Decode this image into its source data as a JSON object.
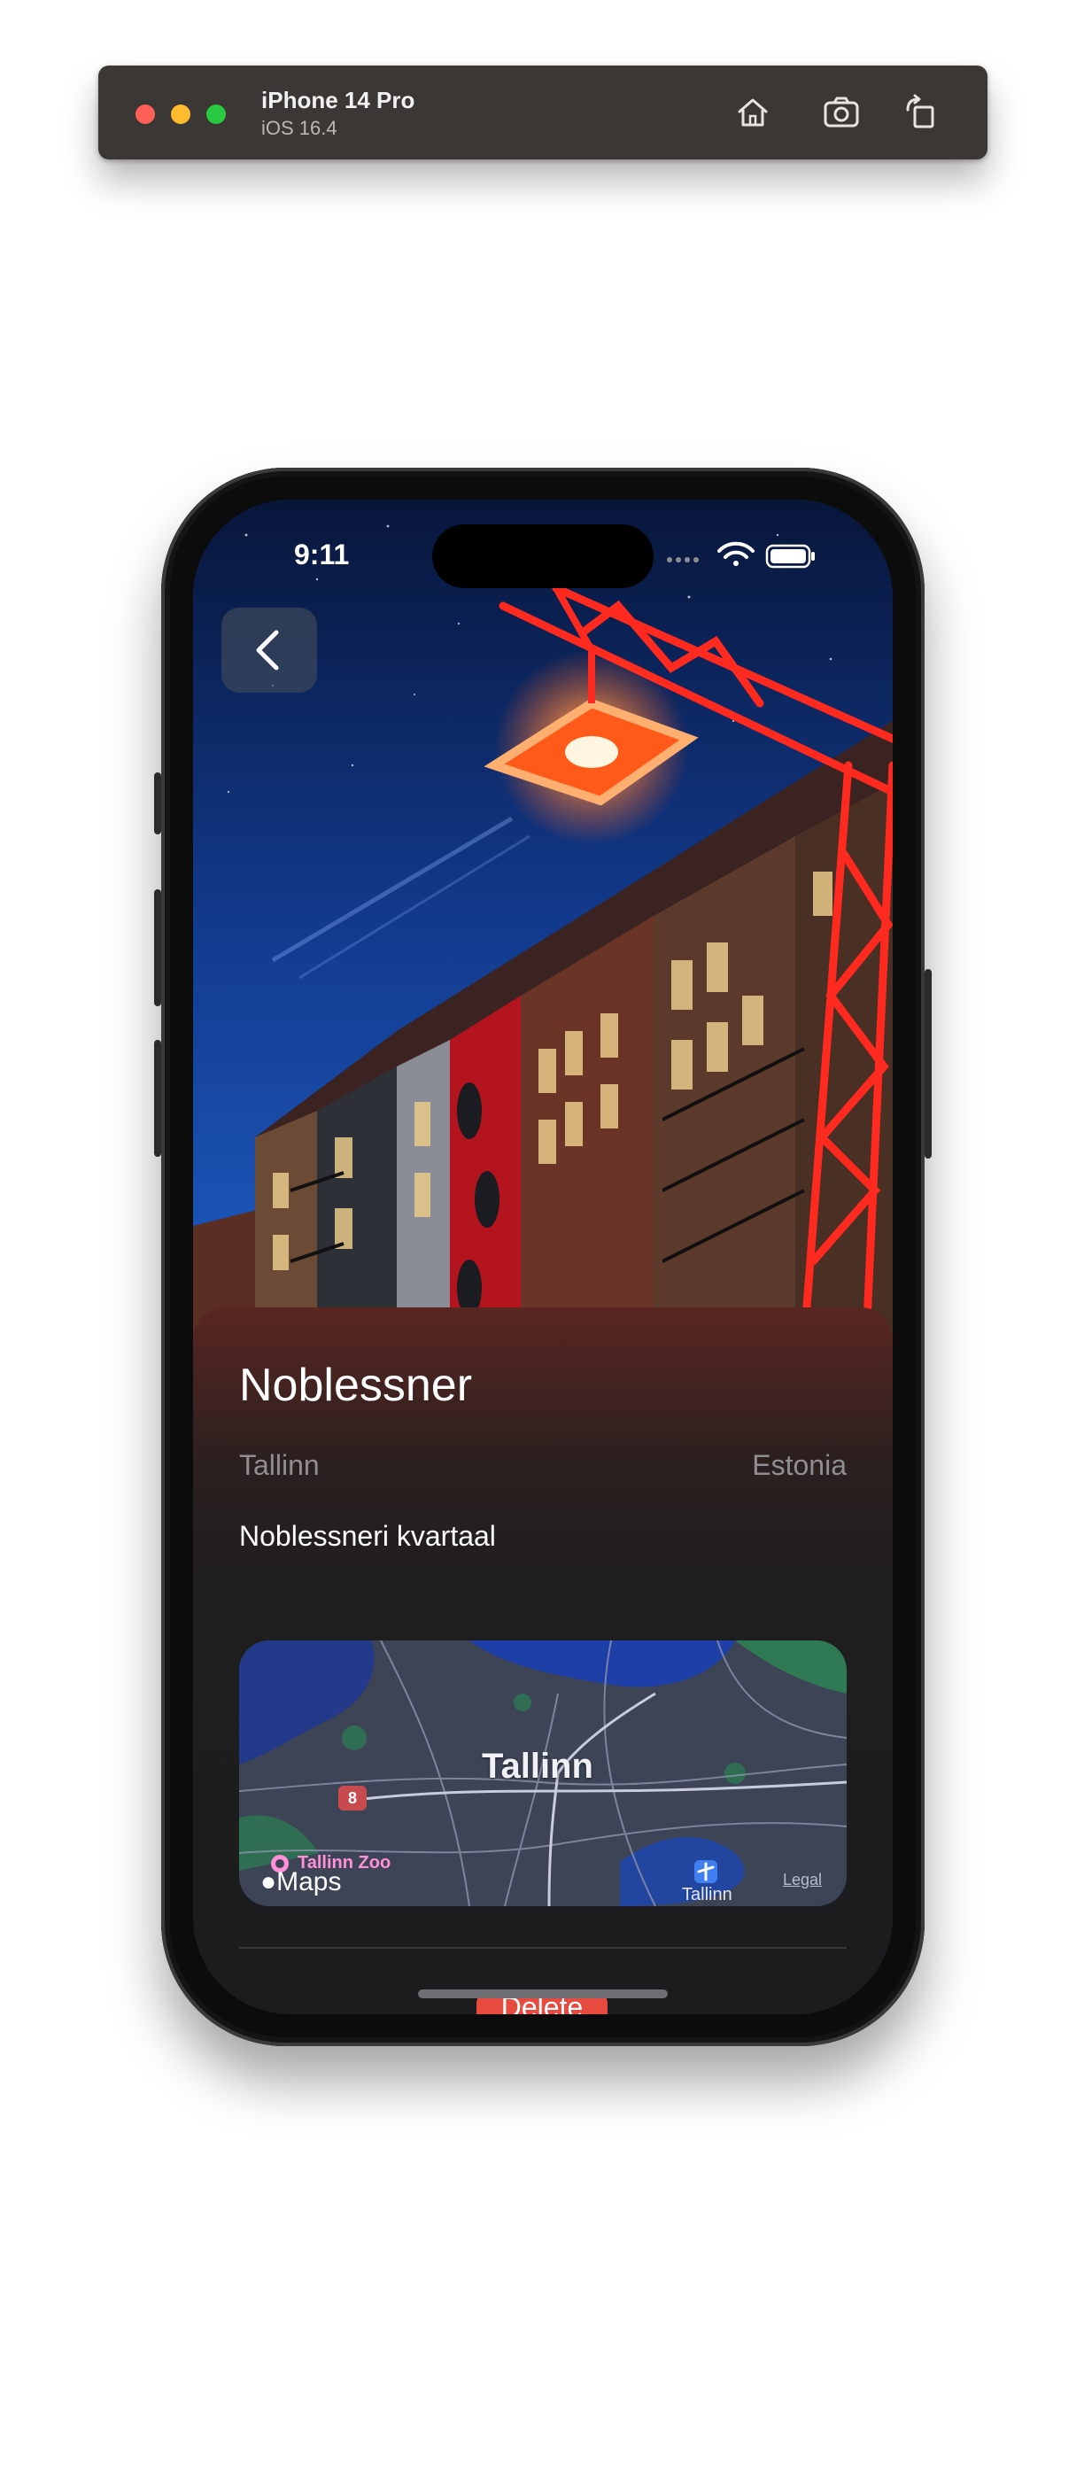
{
  "simulator": {
    "device_name": "iPhone 14 Pro",
    "os_version": "iOS 16.4",
    "tools": [
      "home-icon",
      "screenshot-icon",
      "rotate-icon"
    ]
  },
  "status_bar": {
    "time": "9:11",
    "icons": [
      "cellular-icon",
      "wifi-icon",
      "battery-icon"
    ]
  },
  "navigation": {
    "back_icon": "chevron-left-icon"
  },
  "place": {
    "title": "Noblessner",
    "city": "Tallinn",
    "country": "Estonia",
    "address": "Noblessneri kvartaal"
  },
  "map": {
    "city_label": "Tallinn",
    "route_badge": "8",
    "poi_label": "Tallinn Zoo",
    "brand_label": "Maps",
    "airport_label": "Tallinn",
    "legal_label": "Legal"
  },
  "actions": {
    "delete_label": "Delete"
  },
  "colors": {
    "accent_delete": "#e74a3f",
    "sheet_background": "#1c1c1e",
    "secondary_text": "#8e8e93"
  }
}
